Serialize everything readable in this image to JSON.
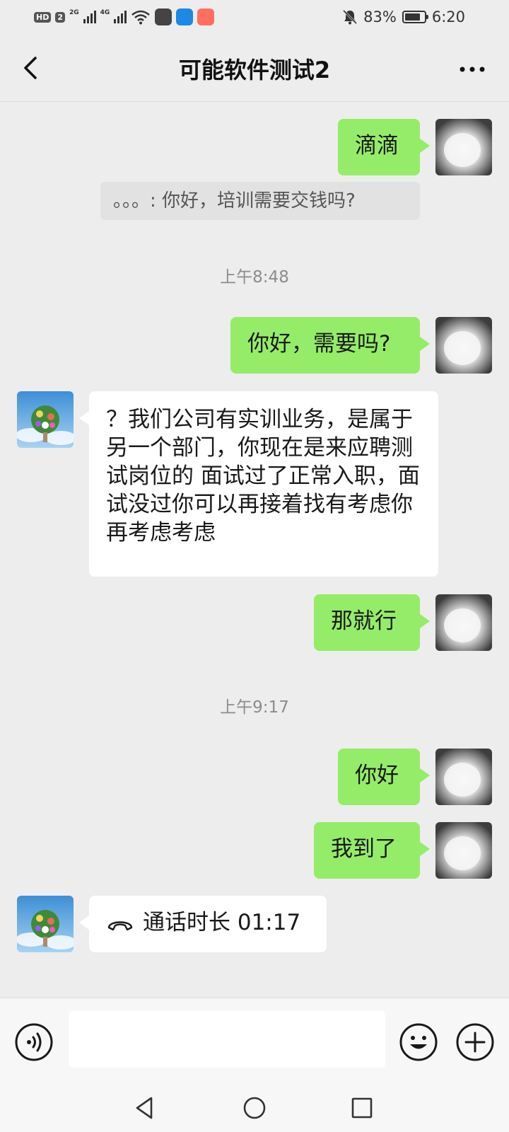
{
  "status_bar": {
    "hd": "HD",
    "sim": "2",
    "net1": "2G",
    "net2": "4G",
    "battery": "83%",
    "time": "6:20"
  },
  "header": {
    "title": "可能软件测试2"
  },
  "messages": {
    "m1": "滴滴",
    "quote": "。。。: 你好，培训需要交钱吗?",
    "t1": "上午8:48",
    "m2": "你好，需要吗?",
    "m3": "？我们公司有实训业务，是属于另一个部门，你现在是来应聘测试岗位的 面试过了正常入职，面试没过你可以再接着找有考虑你再考虑考虑",
    "m4": "那就行",
    "t2": "上午9:17",
    "m5": "你好",
    "m6": "我到了",
    "call": "通话时长 01:17"
  },
  "colors": {
    "sent_bubble": "#95ec69",
    "recv_bubble": "#ffffff",
    "background": "#ededed"
  },
  "icons": {
    "back": "chevron-left-icon",
    "more": "more-dots-icon",
    "voice": "voice-icon",
    "emoji": "emoji-icon",
    "plus": "plus-icon",
    "call": "phone-hangup-icon"
  }
}
